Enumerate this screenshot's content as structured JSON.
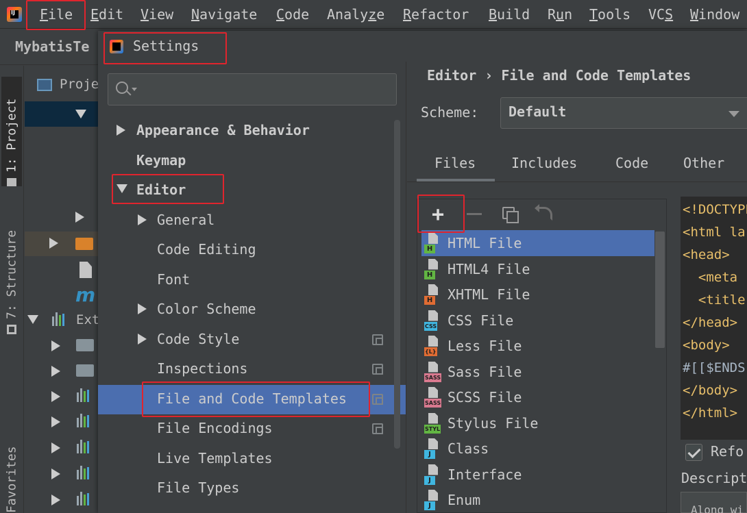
{
  "menubar": {
    "items": [
      {
        "pre": "",
        "u": "F",
        "post": "ile"
      },
      {
        "pre": "",
        "u": "E",
        "post": "dit"
      },
      {
        "pre": "",
        "u": "V",
        "post": "iew"
      },
      {
        "pre": "",
        "u": "N",
        "post": "avigate"
      },
      {
        "pre": "",
        "u": "C",
        "post": "ode"
      },
      {
        "pre": "Analy",
        "u": "z",
        "post": "e"
      },
      {
        "pre": "",
        "u": "R",
        "post": "efactor"
      },
      {
        "pre": "",
        "u": "B",
        "post": "uild"
      },
      {
        "pre": "R",
        "u": "u",
        "post": "n"
      },
      {
        "pre": "",
        "u": "T",
        "post": "ools"
      },
      {
        "pre": "VC",
        "u": "S",
        "post": ""
      },
      {
        "pre": "",
        "u": "W",
        "post": "indow"
      }
    ]
  },
  "main_window": {
    "project_name": "MybatisTe",
    "project_tool_title": "Proje",
    "external_libraries_label": "Ext",
    "stripes": {
      "project": "1: Project",
      "structure": "7: Structure",
      "favorites": "Favorites"
    }
  },
  "settings": {
    "title": "Settings",
    "search_placeholder": "",
    "tree": {
      "appearance": "Appearance & Behavior",
      "keymap": "Keymap",
      "editor": "Editor",
      "general": "General",
      "code_editing": "Code Editing",
      "font": "Font",
      "color_scheme": "Color Scheme",
      "code_style": "Code Style",
      "inspections": "Inspections",
      "file_code_templates": "File and Code Templates",
      "file_encodings": "File Encodings",
      "live_templates": "Live Templates",
      "file_types": "File Types"
    },
    "breadcrumb": "Editor › File and Code Templates",
    "scheme_label": "Scheme:",
    "scheme_value": "Default",
    "tabs": {
      "files": "Files",
      "includes": "Includes",
      "code": "Code",
      "other": "Other"
    },
    "toolbar": {
      "add": "+"
    },
    "files": [
      {
        "name": "HTML File",
        "tag": "H",
        "color": "#62b543"
      },
      {
        "name": "HTML4 File",
        "tag": "H",
        "color": "#62b543"
      },
      {
        "name": "XHTML File",
        "tag": "H",
        "color": "#e06c33"
      },
      {
        "name": "CSS File",
        "tag": "CSS",
        "color": "#40b6e0"
      },
      {
        "name": "Less File",
        "tag": "{L}",
        "color": "#e06c33"
      },
      {
        "name": "Sass File",
        "tag": "SASS",
        "color": "#d9798f"
      },
      {
        "name": "SCSS File",
        "tag": "SASS",
        "color": "#d9798f"
      },
      {
        "name": "Stylus File",
        "tag": "STYL",
        "color": "#62b543"
      },
      {
        "name": "Class",
        "tag": "J",
        "color": "#40b6e0"
      },
      {
        "name": "Interface",
        "tag": "J",
        "color": "#40b6e0"
      },
      {
        "name": "Enum",
        "tag": "J",
        "color": "#40b6e0"
      }
    ],
    "template_code": [
      "<!DOCTYPE",
      "<html la",
      "<head>",
      "  <meta",
      "  <title",
      "</head>",
      "<body>",
      "#[[$ENDS",
      "</body>",
      "</html>"
    ],
    "reformat_label": "Refo",
    "description_label": "Descript",
    "description_text": "Along wi"
  },
  "colors": {
    "annotation_red": "#e0242d",
    "selection_blue": "#4b6eaf"
  }
}
